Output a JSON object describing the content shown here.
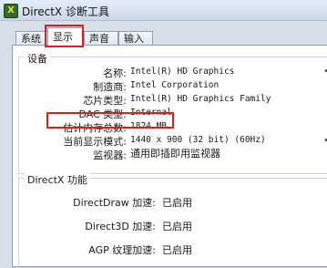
{
  "window": {
    "title": "DirectX 诊断工具",
    "icon": "directx-icon"
  },
  "tabs": [
    {
      "label": "系统",
      "active": false
    },
    {
      "label": "显示",
      "active": true
    },
    {
      "label": "声音",
      "active": false
    },
    {
      "label": "输入",
      "active": false
    }
  ],
  "device": {
    "group_label": "设备",
    "rows": [
      {
        "label": "名称:",
        "value": "Intel(R) HD Graphics"
      },
      {
        "label": "制造商:",
        "value": "Intel Corporation"
      },
      {
        "label": "芯片类型:",
        "value": "Intel(R) HD Graphics Family"
      },
      {
        "label": "DAC 类型:",
        "value": "Internal"
      },
      {
        "label": "估计内存总数:",
        "value": "1824 MB"
      },
      {
        "label": "当前显示模式:",
        "value": "1440 x 900 (32 bit) (60Hz)"
      },
      {
        "label": "监视器:",
        "value": "通用即插即用监视器"
      }
    ]
  },
  "directx": {
    "group_label": "DirectX 功能",
    "rows": [
      {
        "label": "DirectDraw 加速:",
        "value": "已启用"
      },
      {
        "label": "Direct3D 加速:",
        "value": "已启用"
      },
      {
        "label": "AGP 纹理加速:",
        "value": "已启用"
      }
    ]
  },
  "colors": {
    "highlight": "#d82020",
    "window_bg": "#d7dfe9",
    "panel_bg": "#ffffff"
  }
}
